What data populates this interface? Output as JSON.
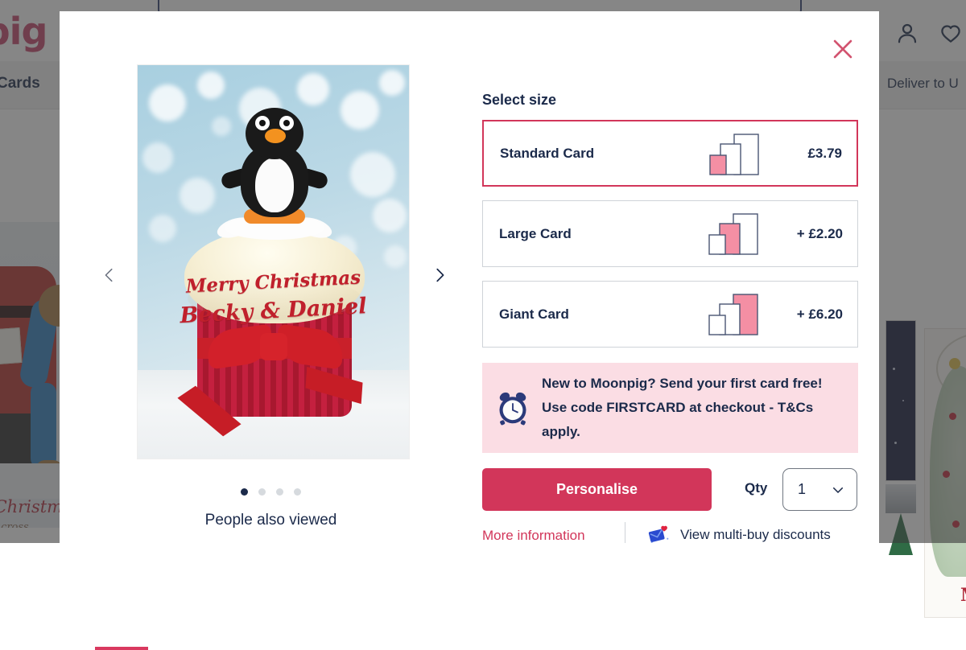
{
  "background": {
    "logo_text": "npig",
    "nav_cards": "Cards",
    "deliver_to": "Deliver to U",
    "account_icon": "account-icon",
    "wishlist_icon": "heart-icon",
    "left_card_text_line1": "rry Christm",
    "left_card_text_line2": "from across",
    "right_card_text": "ME"
  },
  "modal": {
    "close_icon": "close-icon",
    "gallery": {
      "prev_icon": "chevron-left-icon",
      "next_icon": "chevron-right-icon",
      "hero_text_line1": "Merry Christmas",
      "hero_text_line2": "Becky & Daniel",
      "dots": [
        {
          "active": true
        },
        {
          "active": false
        },
        {
          "active": false
        },
        {
          "active": false
        }
      ],
      "people_also_viewed": "People also viewed"
    },
    "panel": {
      "select_size_title": "Select size",
      "sizes": [
        {
          "name": "Standard Card",
          "price": "£3.79",
          "selected": true,
          "icon": "card-size-standard-icon",
          "highlight": "small"
        },
        {
          "name": "Large Card",
          "price": "+ £2.20",
          "selected": false,
          "icon": "card-size-large-icon",
          "highlight": "medium"
        },
        {
          "name": "Giant Card",
          "price": "+ £6.20",
          "selected": false,
          "icon": "card-size-giant-icon",
          "highlight": "large"
        }
      ],
      "promo": {
        "icon": "alarm-clock-icon",
        "text": "New to Moonpig? Send your first card free! Use code FIRSTCARD at checkout - T&Cs apply."
      },
      "personalise_label": "Personalise",
      "qty_label": "Qty",
      "qty_value": "1",
      "qty_chevron_icon": "chevron-down-icon",
      "more_information_label": "More information",
      "multibuy_icon": "card-heart-icon",
      "multibuy_label": "View multi-buy discounts"
    }
  },
  "colors": {
    "brand_pink": "#d2365a",
    "navy": "#1b2a4a",
    "promo_bg": "#fbdde4",
    "size_fill_pink": "#f48fa4",
    "border_grey": "#cfd3d8"
  }
}
